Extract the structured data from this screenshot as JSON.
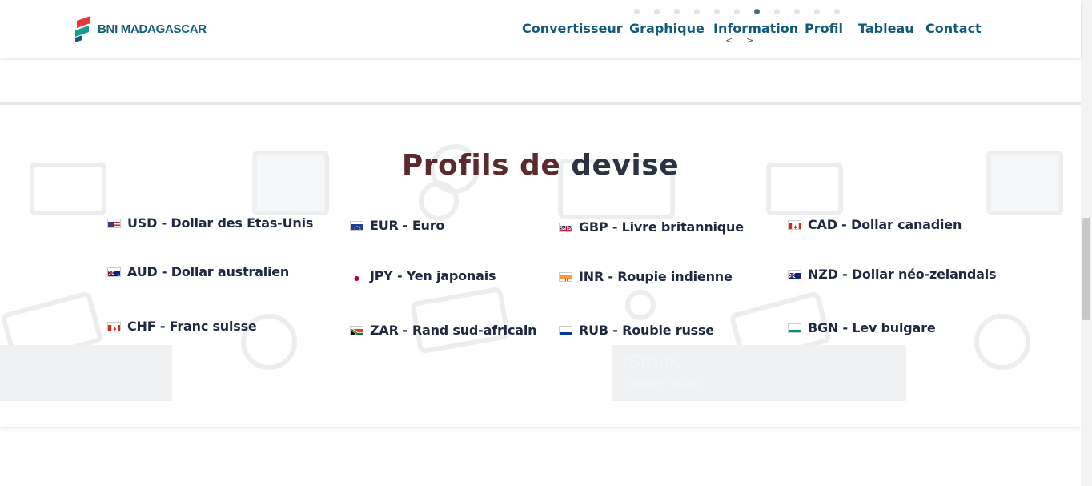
{
  "brand": {
    "name": "BNI MADAGASCAR",
    "colors": {
      "red": "#e43a3f",
      "teal": "#1d9a8f",
      "blue": "#155f7a"
    }
  },
  "nav": {
    "items": [
      "Convertisseur",
      "Graphique",
      "Information",
      "Profil",
      "Tableau",
      "Contact"
    ],
    "slider_prev": "<",
    "slider_next": ">",
    "dot_count": 11,
    "active_dot": 7
  },
  "section": {
    "title_part1": "Profils de",
    "title_part2": "devise",
    "watermark_text_1": "iStock",
    "watermark_text_2": "Credit: Valtar"
  },
  "currencies": [
    {
      "code": "USD",
      "label": "USD - Dollar des Etas-Unis",
      "flag": "us-flag"
    },
    {
      "code": "EUR",
      "label": "EUR - Euro",
      "flag": "eu-flag"
    },
    {
      "code": "GBP",
      "label": "GBP - Livre britannique",
      "flag": "uk-flag"
    },
    {
      "code": "CAD",
      "label": "CAD - Dollar canadien",
      "flag": "ca-flag"
    },
    {
      "code": "AUD",
      "label": "AUD - Dollar australien",
      "flag": "au-flag"
    },
    {
      "code": "JPY",
      "label": "JPY - Yen japonais",
      "flag": "jp-flag"
    },
    {
      "code": "INR",
      "label": "INR - Roupie indienne",
      "flag": "in-flag"
    },
    {
      "code": "NZD",
      "label": "NZD - Dollar néo-zelandais",
      "flag": "nz-flag"
    },
    {
      "code": "CHF",
      "label": "CHF - Franc suisse",
      "flag": "ch-flag"
    },
    {
      "code": "ZAR",
      "label": "ZAR - Rand sud-africain",
      "flag": "za-flag"
    },
    {
      "code": "RUB",
      "label": "RUB - Rouble russe",
      "flag": "ru-flag"
    },
    {
      "code": "BGN",
      "label": "BGN - Lev bulgare",
      "flag": "bg-flag"
    }
  ]
}
